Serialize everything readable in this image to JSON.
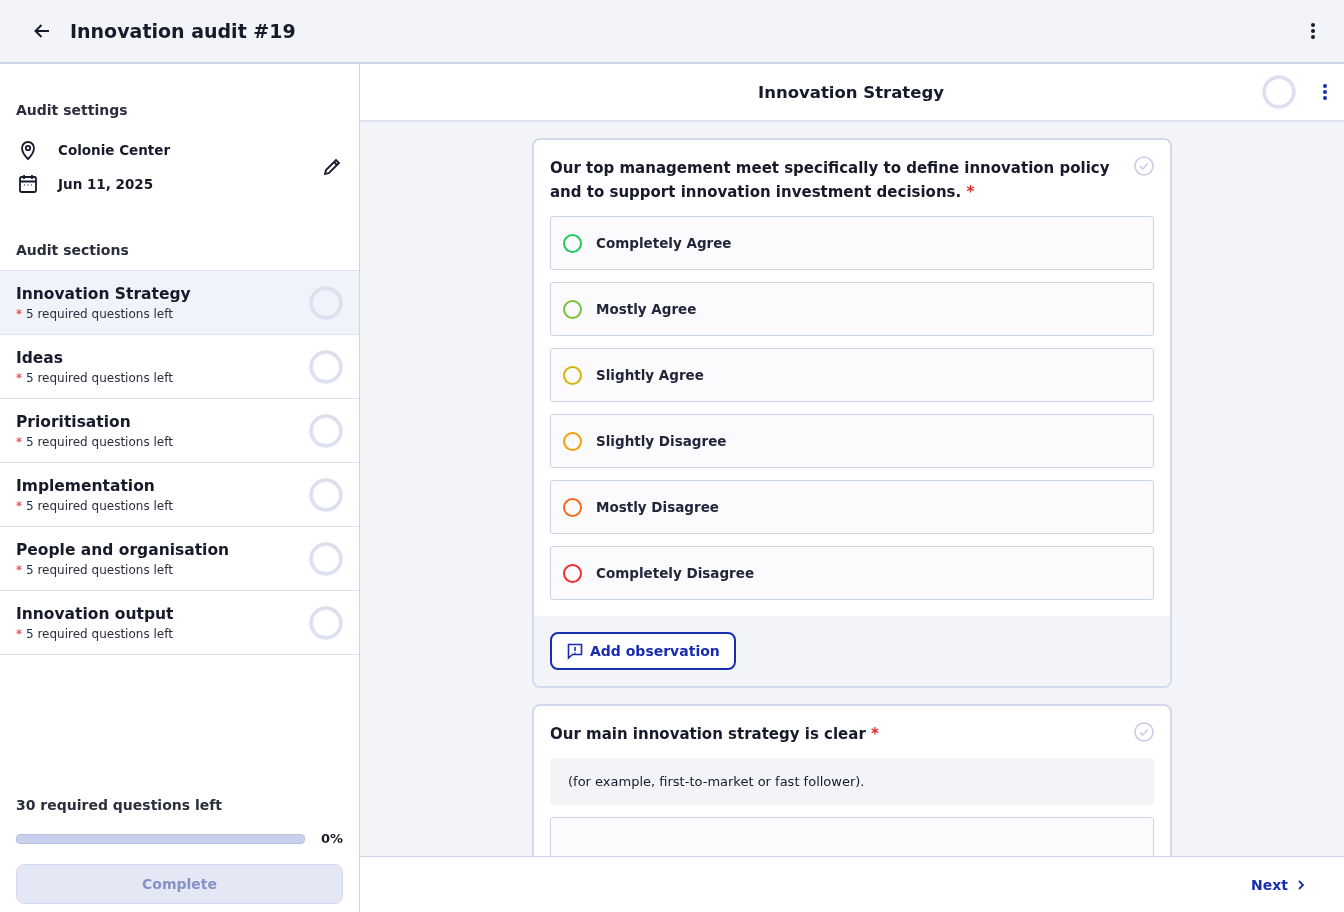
{
  "header": {
    "title": "Innovation audit #19"
  },
  "sidebar": {
    "settings_heading": "Audit settings",
    "location": "Colonie Center",
    "date": "Jun 11, 2025",
    "sections_heading": "Audit sections",
    "sections": [
      {
        "title": "Innovation Strategy",
        "required_mark": "*",
        "subtitle": "5 required questions left",
        "selected": true
      },
      {
        "title": "Ideas",
        "required_mark": "*",
        "subtitle": "5 required questions left",
        "selected": false
      },
      {
        "title": "Prioritisation",
        "required_mark": "*",
        "subtitle": "5 required questions left",
        "selected": false
      },
      {
        "title": "Implementation",
        "required_mark": "*",
        "subtitle": "5 required questions left",
        "selected": false
      },
      {
        "title": "People and organisation",
        "required_mark": "*",
        "subtitle": "5 required questions left",
        "selected": false
      },
      {
        "title": "Innovation output",
        "required_mark": "*",
        "subtitle": "5 required questions left",
        "selected": false
      }
    ],
    "summary": "30 required questions left",
    "progress": {
      "level": 0,
      "reading": "0%"
    },
    "complete_button": {
      "label": "Complete",
      "disabled": true
    }
  },
  "main": {
    "section_title": "Innovation Strategy",
    "questions": [
      {
        "text": "Our top management meet specifically to define innovation policy and to support innovation investment decisions.",
        "required_mark": "*",
        "options": [
          {
            "label": "Completely Agree",
            "color": "#22c55e",
            "selected": false
          },
          {
            "label": "Mostly Agree",
            "color": "#7cc13b",
            "selected": false
          },
          {
            "label": "Slightly Agree",
            "color": "#d4b40a",
            "selected": false
          },
          {
            "label": "Slightly Disagree",
            "color": "#f5a00b",
            "selected": false
          },
          {
            "label": "Mostly Disagree",
            "color": "#f26a1b",
            "selected": false
          },
          {
            "label": "Completely Disagree",
            "color": "#ef2f2f",
            "selected": false
          }
        ],
        "observation_button": "Add observation"
      },
      {
        "text": "Our main innovation strategy is clear",
        "required_mark": "*",
        "hint": "(for example, first-to-market or fast follower).",
        "more_below": true
      }
    ],
    "next_button": "Next"
  }
}
